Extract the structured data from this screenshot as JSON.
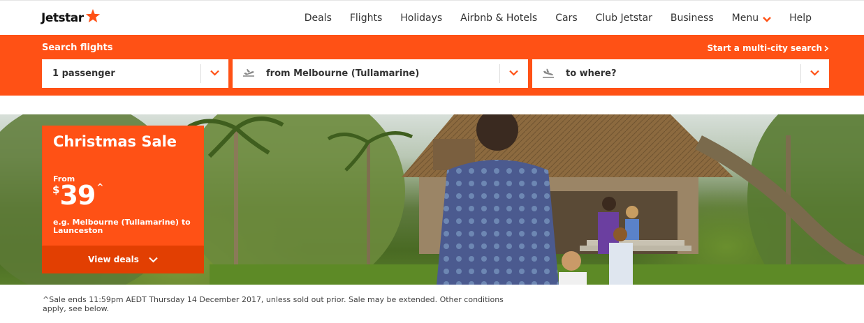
{
  "brand": {
    "name": "Jetstar",
    "accent": "#ff5115",
    "accent_dark": "#e23f02"
  },
  "nav": {
    "items": [
      "Deals",
      "Flights",
      "Holidays",
      "Airbnb & Hotels",
      "Cars",
      "Club Jetstar",
      "Business",
      "Menu",
      "Help"
    ]
  },
  "search": {
    "title": "Search flights",
    "multi_city": "Start a multi-city search",
    "passengers": "1 passenger",
    "from": "from Melbourne (Tullamarine)",
    "to": "to where?"
  },
  "promo": {
    "title": "Christmas Sale",
    "from_label": "From",
    "currency": "$",
    "price": "39",
    "price_suffix": "^",
    "route": "e.g. Melbourne (Tullamarine) to Launceston",
    "cta": "View deals"
  },
  "disclaimer": "^Sale ends 11:59pm AEDT Thursday 14 December 2017, unless sold out prior. Sale may be extended. Other conditions apply, see below."
}
